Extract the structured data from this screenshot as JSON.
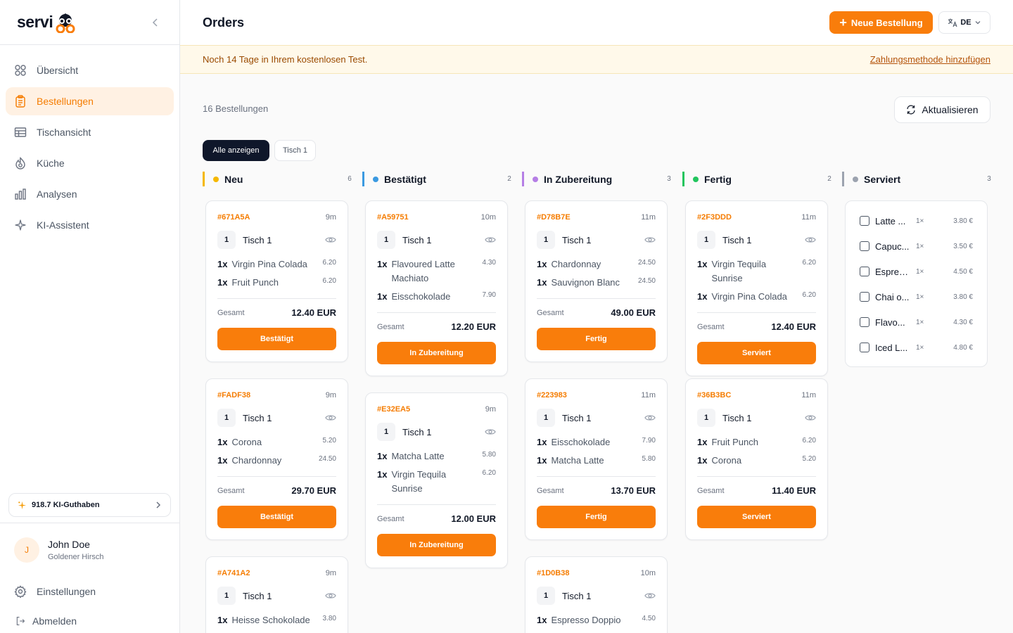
{
  "brand": {
    "name": "servi"
  },
  "nav": [
    {
      "label": "Übersicht",
      "icon": "grid-icon",
      "active": false
    },
    {
      "label": "Bestellungen",
      "icon": "clipboard-icon",
      "active": true
    },
    {
      "label": "Tischansicht",
      "icon": "table-icon",
      "active": false
    },
    {
      "label": "Küche",
      "icon": "flame-icon",
      "active": false
    },
    {
      "label": "Analysen",
      "icon": "bar-chart-icon",
      "active": false
    },
    {
      "label": "KI-Assistent",
      "icon": "sparkle-icon",
      "active": false
    }
  ],
  "credits": {
    "label": "918.7 KI-Guthaben"
  },
  "user": {
    "initial": "J",
    "name": "John Doe",
    "place": "Goldener Hirsch"
  },
  "settings_label": "Einstellungen",
  "logout_label": "Abmelden",
  "header": {
    "title": "Orders",
    "new_order": "Neue Bestellung",
    "lang": "DE"
  },
  "banner": {
    "text": "Noch 14 Tage in Ihrem kostenlosen Test.",
    "link": "Zahlungsmethode hinzufügen"
  },
  "count_label": "16 Bestellungen",
  "refresh_label": "Aktualisieren",
  "filters": {
    "all": "Alle anzeigen",
    "table1": "Tisch 1"
  },
  "colors": {
    "accent": "#f97d0b",
    "neu": "#f5b800",
    "bestaetigt": "#3b9ae1",
    "zubereitung": "#b57ee5",
    "fertig": "#22c55e",
    "serviert": "#9ca3af"
  },
  "columns": [
    {
      "title": "Neu",
      "count": "6",
      "cards": [
        {
          "id": "#671A5A",
          "age": "9m",
          "table_no": "1",
          "table": "Tisch 1",
          "items": [
            {
              "q": "1x",
              "n": "Virgin Pina Colada",
              "p": "6.20"
            },
            {
              "q": "1x",
              "n": "Fruit Punch",
              "p": "6.20"
            }
          ],
          "total_label": "Gesamt",
          "total": "12.40 EUR",
          "action": "Bestätigt"
        },
        {
          "id": "#FADF38",
          "age": "9m",
          "table_no": "1",
          "table": "Tisch 1",
          "items": [
            {
              "q": "1x",
              "n": "Corona",
              "p": "5.20"
            },
            {
              "q": "1x",
              "n": "Chardonnay",
              "p": "24.50"
            }
          ],
          "total_label": "Gesamt",
          "total": "29.70 EUR",
          "action": "Bestätigt"
        },
        {
          "id": "#A741A2",
          "age": "9m",
          "table_no": "1",
          "table": "Tisch 1",
          "items": [
            {
              "q": "1x",
              "n": "Heisse Schokolade",
              "p": "3.80"
            }
          ],
          "total_label": "",
          "total": "",
          "action": ""
        }
      ]
    },
    {
      "title": "Bestätigt",
      "count": "2",
      "cards": [
        {
          "id": "#A59751",
          "age": "10m",
          "table_no": "1",
          "table": "Tisch 1",
          "items": [
            {
              "q": "1x",
              "n": "Flavoured Latte Machiato",
              "p": "4.30"
            },
            {
              "q": "1x",
              "n": "Eisschokolade",
              "p": "7.90"
            }
          ],
          "total_label": "Gesamt",
          "total": "12.20 EUR",
          "action": "In Zubereitung"
        },
        {
          "id": "#E32EA5",
          "age": "9m",
          "table_no": "1",
          "table": "Tisch 1",
          "items": [
            {
              "q": "1x",
              "n": "Matcha Latte",
              "p": "5.80"
            },
            {
              "q": "1x",
              "n": "Virgin Tequila Sunrise",
              "p": "6.20"
            }
          ],
          "total_label": "Gesamt",
          "total": "12.00 EUR",
          "action": "In Zubereitung"
        }
      ]
    },
    {
      "title": "In Zubereitung",
      "count": "3",
      "cards": [
        {
          "id": "#D78B7E",
          "age": "11m",
          "table_no": "1",
          "table": "Tisch 1",
          "items": [
            {
              "q": "1x",
              "n": "Chardonnay",
              "p": "24.50"
            },
            {
              "q": "1x",
              "n": "Sauvignon Blanc",
              "p": "24.50"
            }
          ],
          "total_label": "Gesamt",
          "total": "49.00 EUR",
          "action": "Fertig"
        },
        {
          "id": "#223983",
          "age": "11m",
          "table_no": "1",
          "table": "Tisch 1",
          "items": [
            {
              "q": "1x",
              "n": "Eisschokolade",
              "p": "7.90"
            },
            {
              "q": "1x",
              "n": "Matcha Latte",
              "p": "5.80"
            }
          ],
          "total_label": "Gesamt",
          "total": "13.70 EUR",
          "action": "Fertig"
        },
        {
          "id": "#1D0B38",
          "age": "10m",
          "table_no": "1",
          "table": "Tisch 1",
          "items": [
            {
              "q": "1x",
              "n": "Espresso Doppio",
              "p": "4.50"
            }
          ],
          "total_label": "",
          "total": "",
          "action": ""
        }
      ]
    },
    {
      "title": "Fertig",
      "count": "2",
      "cards": [
        {
          "id": "#2F3DDD",
          "age": "11m",
          "table_no": "1",
          "table": "Tisch 1",
          "items": [
            {
              "q": "1x",
              "n": "Virgin Tequila Sunrise",
              "p": "6.20"
            },
            {
              "q": "1x",
              "n": "Virgin Pina Colada",
              "p": "6.20"
            }
          ],
          "total_label": "Gesamt",
          "total": "12.40 EUR",
          "action": "Serviert"
        },
        {
          "id": "#36B3BC",
          "age": "11m",
          "table_no": "1",
          "table": "Tisch 1",
          "items": [
            {
              "q": "1x",
              "n": "Fruit Punch",
              "p": "6.20"
            },
            {
              "q": "1x",
              "n": "Corona",
              "p": "5.20"
            }
          ],
          "total_label": "Gesamt",
          "total": "11.40 EUR",
          "action": "Serviert"
        }
      ]
    }
  ],
  "served": {
    "title": "Serviert",
    "count": "3",
    "items": [
      {
        "n": "Latte ...",
        "q": "1×",
        "p": "3.80 €"
      },
      {
        "n": "Capuc...",
        "q": "1×",
        "p": "3.50 €"
      },
      {
        "n": "Espres...",
        "q": "1×",
        "p": "4.50 €"
      },
      {
        "n": "Chai o...",
        "q": "1×",
        "p": "3.80 €"
      },
      {
        "n": "Flavo...",
        "q": "1×",
        "p": "4.30 €"
      },
      {
        "n": "Iced L...",
        "q": "1×",
        "p": "4.80 €"
      }
    ]
  }
}
